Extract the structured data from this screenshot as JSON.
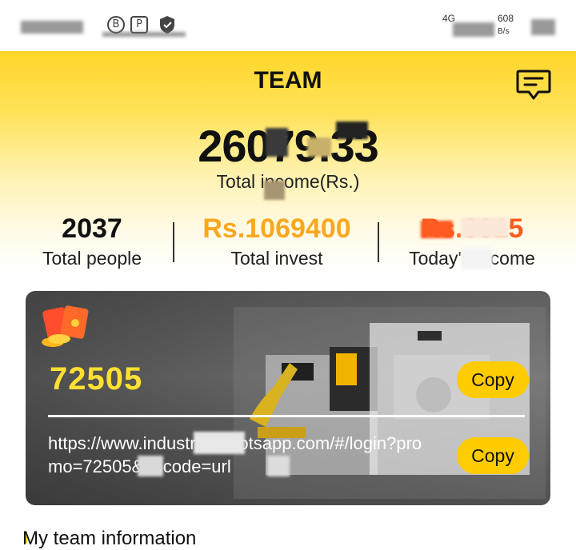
{
  "status_bar": {
    "network": "4G",
    "speed_value": "608",
    "speed_unit": "B/s"
  },
  "header": {
    "title": "TEAM",
    "message_icon": "message-icon"
  },
  "summary": {
    "total_income_value": "26079.33",
    "total_income_label": "Total income(Rs.)"
  },
  "stats": [
    {
      "value": "2037",
      "label": "Total people",
      "color": "#111111"
    },
    {
      "value": "Rs.1069400",
      "label": "Total invest",
      "color": "#f9a71f"
    },
    {
      "value": "Rs.3015",
      "label": "Today's income",
      "color": "#ff5a1f"
    }
  ],
  "invite_card": {
    "icon": "red-envelope-icon",
    "invite_code": "72505",
    "copy_label": "Copy",
    "invite_link": "https://www.industrialrobotsapp.com/#/login?promo=72505&encode=url",
    "accent_color": "#ffe132",
    "button_color": "#ffcc00"
  },
  "bottom": {
    "section_title": "My team information"
  }
}
